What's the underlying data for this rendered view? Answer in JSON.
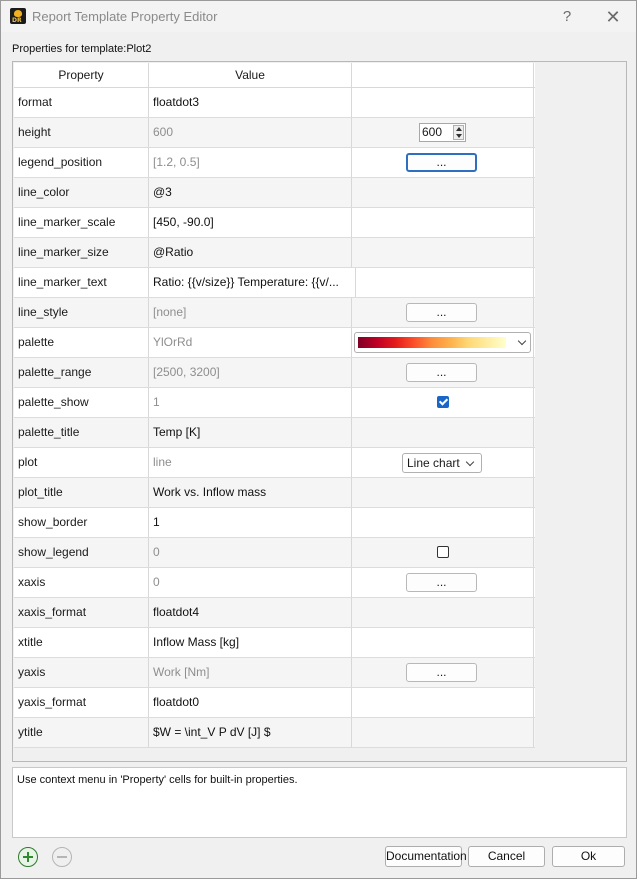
{
  "window": {
    "title": "Report Template Property Editor",
    "help_glyph": "?",
    "close_glyph": "✕",
    "icon_text": "DR"
  },
  "heading": "Properties for template:Plot2",
  "table": {
    "headers": [
      "Property",
      "Value",
      ""
    ],
    "rows": [
      {
        "property": "format",
        "value": "floatdot3"
      },
      {
        "property": "height",
        "value": "600",
        "editor": "600"
      },
      {
        "property": "legend_position",
        "value": "[1.2, 0.5]",
        "editor": "..."
      },
      {
        "property": "line_color",
        "value": "@3"
      },
      {
        "property": "line_marker_scale",
        "value": "[450, -90.0]"
      },
      {
        "property": "line_marker_size",
        "value": "@Ratio"
      },
      {
        "property": "line_marker_text",
        "value": "Ratio: {{v/size}} Temperature: {{v/..."
      },
      {
        "property": "line_style",
        "value": "[none]",
        "editor": "..."
      },
      {
        "property": "palette",
        "value": "YlOrRd"
      },
      {
        "property": "palette_range",
        "value": "[2500, 3200]",
        "editor": "..."
      },
      {
        "property": "palette_show",
        "value": "1",
        "checked": true
      },
      {
        "property": "palette_title",
        "value": "Temp [K]"
      },
      {
        "property": "plot",
        "value": "line",
        "editor": "Line chart"
      },
      {
        "property": "plot_title",
        "value": "Work vs. Inflow mass"
      },
      {
        "property": "show_border",
        "value": "1"
      },
      {
        "property": "show_legend",
        "value": "0",
        "checked": false
      },
      {
        "property": "xaxis",
        "value": "0",
        "editor": "..."
      },
      {
        "property": "xaxis_format",
        "value": "floatdot4"
      },
      {
        "property": "xtitle",
        "value": "Inflow Mass [kg]"
      },
      {
        "property": "yaxis",
        "value": "Work [Nm]",
        "editor": "..."
      },
      {
        "property": "yaxis_format",
        "value": "floatdot0"
      },
      {
        "property": "ytitle",
        "value": "$W = \\int_V P dV [J] $"
      }
    ]
  },
  "help_text": "Use context menu in 'Property' cells for built-in properties.",
  "buttons": {
    "documentation": "Documentation",
    "cancel": "Cancel",
    "ok": "Ok"
  },
  "colors": {
    "accent": "#1a66c8",
    "add_icon": "#2e8b2e",
    "palette_stops": [
      "#800026",
      "#bd0026",
      "#e31a1c",
      "#fc4e2a",
      "#fd8d3c",
      "#feb24c",
      "#fed976",
      "#ffeda0",
      "#ffffcc"
    ]
  }
}
